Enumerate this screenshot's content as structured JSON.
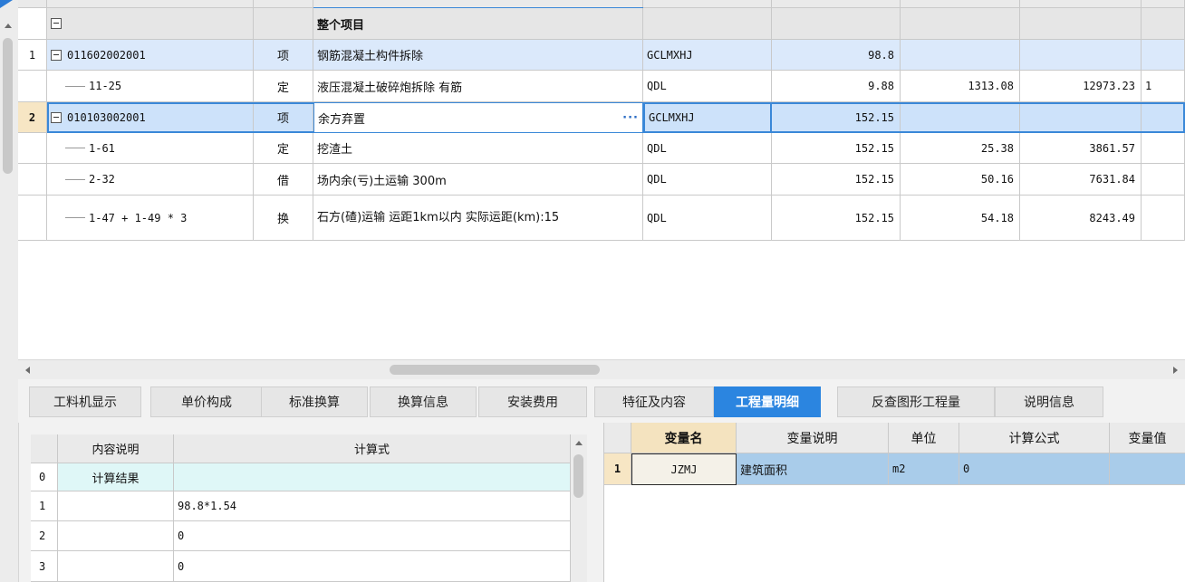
{
  "main_grid": {
    "rows": [
      {
        "idx": "",
        "code": "",
        "type": "",
        "name": "整个项目",
        "unit": "",
        "qty": "",
        "price": "",
        "total": "",
        "extra": ""
      },
      {
        "idx": "1",
        "code": "011602002001",
        "type": "项",
        "name": "钢筋混凝土构件拆除",
        "unit": "GCLMXHJ",
        "qty": "98.8",
        "price": "",
        "total": "",
        "extra": ""
      },
      {
        "idx": "",
        "code": "11-25",
        "type": "定",
        "name": "液压混凝土破碎炮拆除 有筋",
        "unit": "QDL",
        "qty": "9.88",
        "price": "1313.08",
        "total": "12973.23",
        "extra": "1"
      },
      {
        "idx": "2",
        "code": "010103002001",
        "type": "项",
        "name": "余方弃置",
        "unit": "GCLMXHJ",
        "qty": "152.15",
        "price": "",
        "total": "",
        "extra": ""
      },
      {
        "idx": "",
        "code": "1-61",
        "type": "定",
        "name": "挖渣土",
        "unit": "QDL",
        "qty": "152.15",
        "price": "25.38",
        "total": "3861.57",
        "extra": ""
      },
      {
        "idx": "",
        "code": "2-32",
        "type": "借",
        "name": "场内余(亏)土运输 300m",
        "unit": "QDL",
        "qty": "152.15",
        "price": "50.16",
        "total": "7631.84",
        "extra": ""
      },
      {
        "idx": "",
        "code": "1-47 + 1-49 * 3",
        "type": "换",
        "name": "石方(碴)运输 运距1km以内  实际运距(km):15",
        "unit": "QDL",
        "qty": "152.15",
        "price": "54.18",
        "total": "8243.49",
        "extra": ""
      }
    ],
    "edit_button": "···"
  },
  "tabs": [
    {
      "label": "工料机显示"
    },
    {
      "label": "单价构成"
    },
    {
      "label": "标准换算"
    },
    {
      "label": "换算信息"
    },
    {
      "label": "安装费用"
    },
    {
      "label": "特征及内容"
    },
    {
      "label": "工程量明细"
    },
    {
      "label": "反查图形工程量"
    },
    {
      "label": "说明信息"
    }
  ],
  "active_tab": "工程量明细",
  "detail_grid": {
    "headers": [
      "",
      "内容说明",
      "计算式"
    ],
    "rows": [
      {
        "idx": "0",
        "desc": "计算结果",
        "formula": ""
      },
      {
        "idx": "1",
        "desc": "",
        "formula": "98.8*1.54"
      },
      {
        "idx": "2",
        "desc": "",
        "formula": "0"
      },
      {
        "idx": "3",
        "desc": "",
        "formula": "0"
      }
    ]
  },
  "variable_grid": {
    "headers": [
      "",
      "变量名",
      "变量说明",
      "单位",
      "计算公式",
      "变量值"
    ],
    "rows": [
      {
        "idx": "1",
        "name": "JZMJ",
        "desc": "建筑面积",
        "unit": "m2",
        "formula": "0",
        "value": ""
      }
    ]
  },
  "colors": {
    "accent": "#2b85e0",
    "selection": "#cde2fa",
    "row_highlight": "#dbe9fb",
    "result_row": "#dff7f7"
  }
}
